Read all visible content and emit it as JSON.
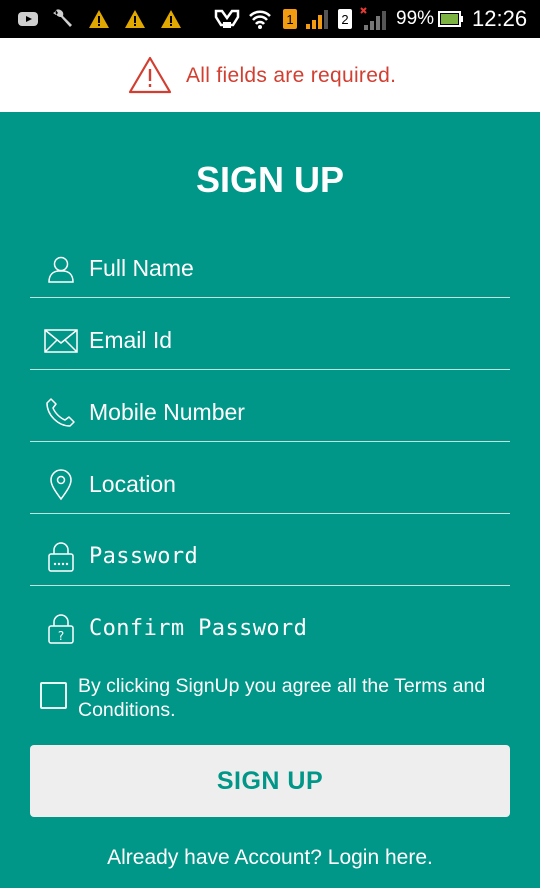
{
  "status_bar": {
    "battery_percent": "99%",
    "clock": "12:26",
    "sim1_label": "1",
    "sim2_label": "2",
    "icons": [
      "youtube-icon",
      "wrench-icon",
      "warning-icon",
      "warning-icon",
      "warning-icon",
      "app-icon",
      "wifi-icon",
      "sim1-signal-icon",
      "sim2-signal-icon",
      "battery-icon"
    ]
  },
  "banner": {
    "message": "All fields are required.",
    "color": "#d23f31"
  },
  "form": {
    "title": "SIGN UP",
    "fields": [
      {
        "placeholder": "Full Name",
        "icon": "user-icon"
      },
      {
        "placeholder": "Email Id",
        "icon": "envelope-icon"
      },
      {
        "placeholder": "Mobile Number",
        "icon": "phone-icon"
      },
      {
        "placeholder": "Location",
        "icon": "location-pin-icon"
      },
      {
        "placeholder": "Password",
        "icon": "lock-icon"
      },
      {
        "placeholder": "Confirm Password",
        "icon": "lock-question-icon"
      }
    ],
    "terms_text": "By clicking SignUp you agree all the Terms and Conditions.",
    "terms_checked": false,
    "submit_label": "SIGN UP",
    "login_text": "Already have Account? Login here."
  },
  "colors": {
    "background": "#009688",
    "button_background": "#eeeeee",
    "button_text": "#009688"
  }
}
